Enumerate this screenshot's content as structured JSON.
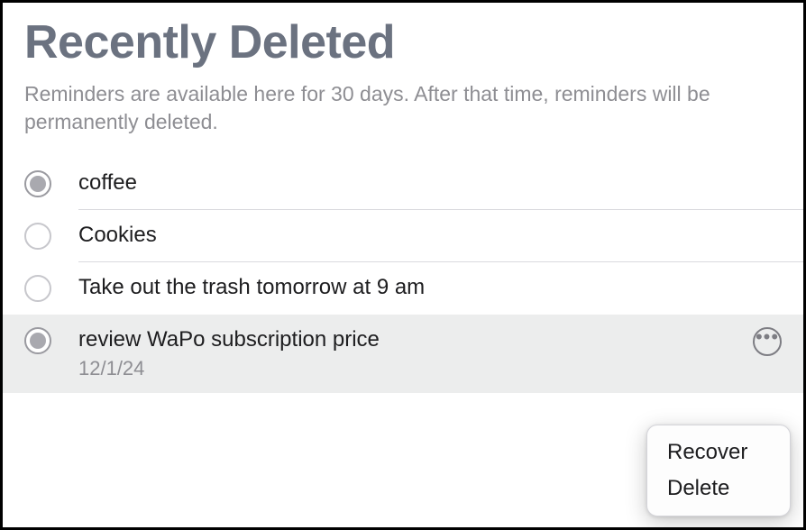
{
  "header": {
    "title": "Recently Deleted",
    "subtitle": "Reminders are available here for 30 days. After that time, reminders will be permanently deleted."
  },
  "reminders": [
    {
      "title": "coffee",
      "completed": true,
      "selected": false,
      "sub": ""
    },
    {
      "title": "Cookies",
      "completed": false,
      "selected": false,
      "sub": ""
    },
    {
      "title": "Take out the trash tomorrow at 9 am",
      "completed": false,
      "selected": false,
      "sub": ""
    },
    {
      "title": "review WaPo subscription price",
      "completed": true,
      "selected": true,
      "sub": "12/1/24"
    }
  ],
  "context_menu": {
    "recover": "Recover",
    "delete": "Delete"
  }
}
